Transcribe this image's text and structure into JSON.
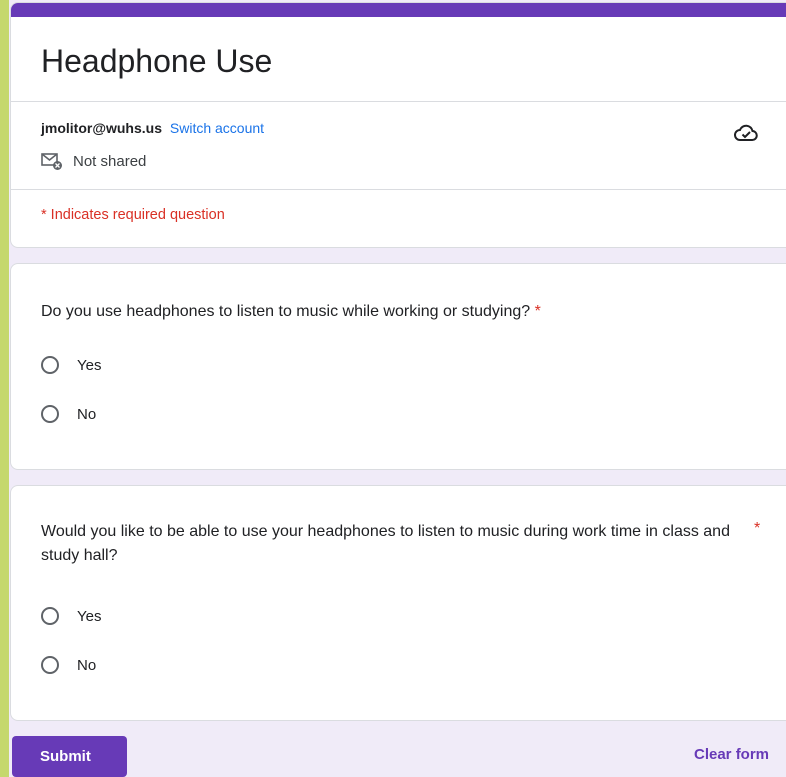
{
  "form": {
    "title": "Headphone Use",
    "account_email": "jmolitor@wuhs.us",
    "switch_account_label": "Switch account",
    "shared_status": "Not shared",
    "required_note": "* Indicates required question",
    "accent_color": "#673ab7",
    "required_color": "#d93025"
  },
  "questions": [
    {
      "title": "Do you use headphones to listen to music while working or studying?",
      "required_mark": "*",
      "options": [
        "Yes",
        "No"
      ]
    },
    {
      "title": "Would you like to be able to use your headphones to listen to music during work time in class and study hall?",
      "required_mark": "*",
      "options": [
        "Yes",
        "No"
      ]
    }
  ],
  "actions": {
    "submit_label": "Submit",
    "clear_label": "Clear form"
  }
}
